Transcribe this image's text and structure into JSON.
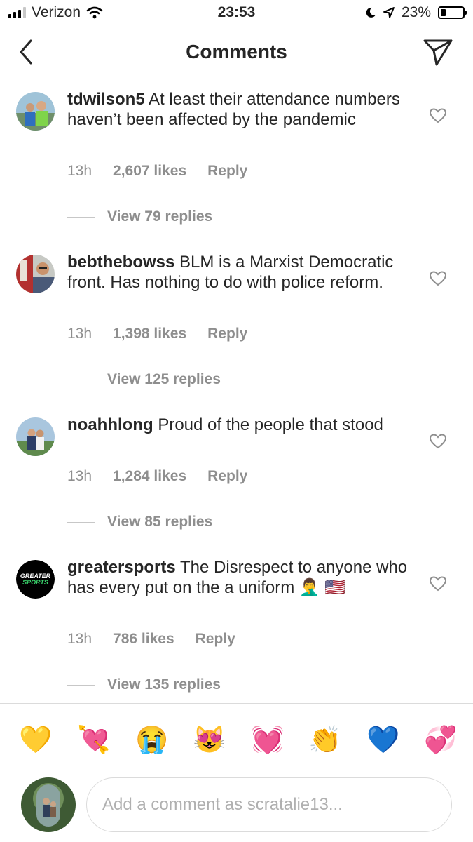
{
  "status_bar": {
    "carrier": "Verizon",
    "time": "23:53",
    "battery": "23%"
  },
  "header": {
    "title": "Comments"
  },
  "comments": [
    {
      "username": "tdwilson5",
      "text": "At least their attendance numbers haven’t been affected by the pandemic",
      "time": "13h",
      "likes": "2,607 likes",
      "reply": "Reply",
      "view_replies": "View 79 replies"
    },
    {
      "username": "bebthebowss",
      "text": "BLM is a Marxist Democratic front. Has nothing to do with police reform.",
      "time": "13h",
      "likes": "1,398 likes",
      "reply": "Reply",
      "view_replies": "View 125 replies"
    },
    {
      "username": "noahhlong",
      "text": "Proud of the people that stood",
      "time": "13h",
      "likes": "1,284 likes",
      "reply": "Reply",
      "view_replies": "View 85 replies"
    },
    {
      "username": "greatersports",
      "text": "The Disrespect to anyone who has every put on the a uniform 🤦‍♂️ 🇺🇸",
      "time": "13h",
      "likes": "786 likes",
      "reply": "Reply",
      "view_replies": "View 135 replies",
      "avatar_text": [
        "GREATER",
        "SPORTS"
      ]
    }
  ],
  "emoji_bar": [
    "💛",
    "💘",
    "😭",
    "😻",
    "💓",
    "👏",
    "💙",
    "💞"
  ],
  "compose": {
    "placeholder": "Add a comment as scratalie13..."
  },
  "colors": {
    "text": "#262626",
    "secondary": "#8e8e8e",
    "divider": "#dbdbdb",
    "sports_green": "#39d36b"
  }
}
